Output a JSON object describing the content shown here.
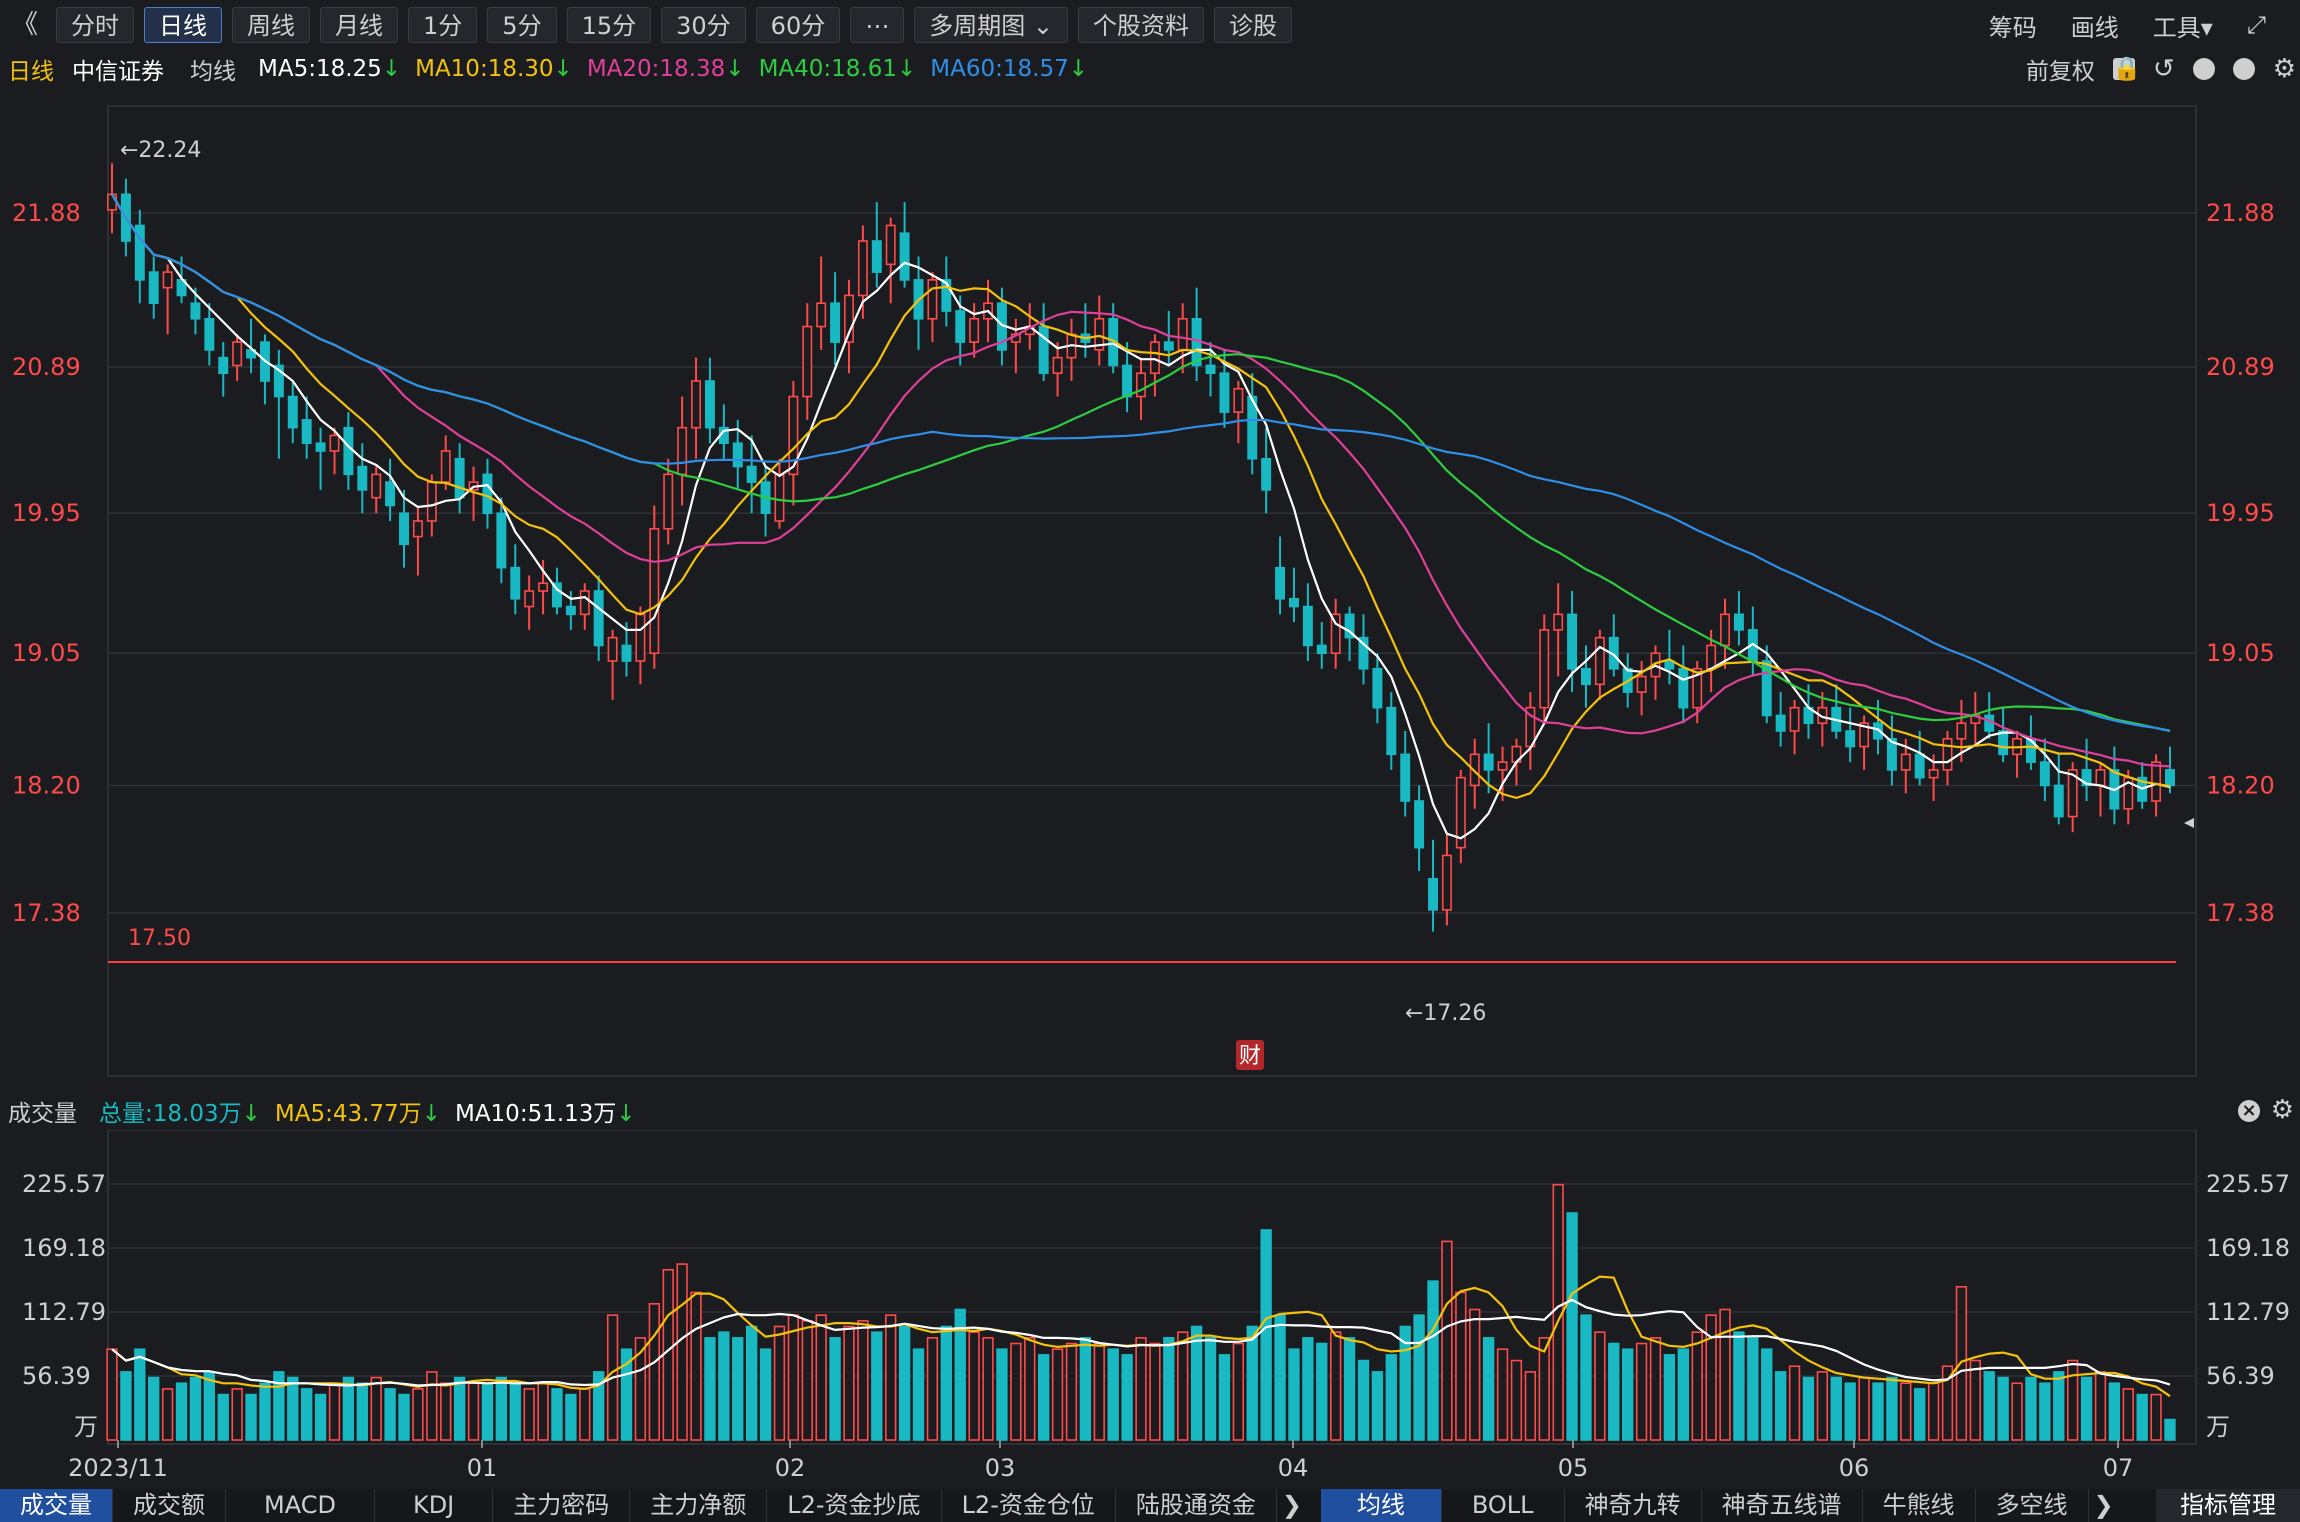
{
  "toolbar": {
    "back": "《",
    "tabs": [
      "分时",
      "日线",
      "周线",
      "月线",
      "1分",
      "5分",
      "15分",
      "30分",
      "60分",
      "⋯",
      "多周期图 ⌄",
      "个股资料",
      "诊股"
    ],
    "active_tab": "日线",
    "right": [
      "筹码",
      "画线",
      "工具▾",
      "⤢"
    ]
  },
  "info": {
    "period": "日线",
    "stock": "中信证券",
    "mode": "均线",
    "ma5": "MA5:18.25",
    "ma10": "MA10:18.30",
    "ma20": "MA20:18.38",
    "ma40": "MA40:18.61",
    "ma60": "MA60:18.57",
    "down": "↓",
    "adjust": "前复权"
  },
  "colors": {
    "up": "#ff4a4a",
    "down": "#19b9c4",
    "ma5": "#ffffff",
    "ma10": "#f4c20d",
    "ma20": "#e0409a",
    "ma40": "#2ecc40",
    "ma60": "#2f8fe8",
    "grid": "#2e3036"
  },
  "price_axis": {
    "ticks": [
      "21.88",
      "20.89",
      "19.95",
      "19.05",
      "18.20",
      "17.38"
    ]
  },
  "annotations": {
    "high": "←22.24",
    "low": "←17.26",
    "support_label": "17.50",
    "finance_badge": "财"
  },
  "volume": {
    "title": "成交量",
    "total": "总量:18.03万",
    "ma5": "MA5:43.77万",
    "ma10": "MA10:51.13万",
    "ticks": [
      "225.57",
      "169.18",
      "112.79",
      "56.39"
    ],
    "unit": "万"
  },
  "x_axis": {
    "labels": [
      "2023/11",
      "01",
      "02",
      "03",
      "04",
      "05",
      "06",
      "07"
    ]
  },
  "chart_data": {
    "type": "candlestick",
    "ylim": [
      17.1,
      22.5
    ],
    "volume_ylim": [
      0,
      240
    ],
    "x_labels": [
      "2023/11",
      "01",
      "02",
      "03",
      "04",
      "05",
      "06",
      "07"
    ],
    "candles_ohlcv": [
      [
        21.9,
        22.2,
        21.75,
        22.0,
        80
      ],
      [
        22.0,
        22.1,
        21.6,
        21.7,
        60
      ],
      [
        21.8,
        21.9,
        21.3,
        21.45,
        80
      ],
      [
        21.5,
        21.6,
        21.2,
        21.3,
        55
      ],
      [
        21.4,
        21.55,
        21.1,
        21.5,
        45
      ],
      [
        21.45,
        21.6,
        21.3,
        21.35,
        50
      ],
      [
        21.3,
        21.4,
        21.1,
        21.2,
        55
      ],
      [
        21.2,
        21.3,
        20.9,
        21.0,
        60
      ],
      [
        20.95,
        21.05,
        20.7,
        20.85,
        40
      ],
      [
        20.9,
        21.1,
        20.8,
        21.05,
        45
      ],
      [
        21.0,
        21.2,
        20.85,
        20.95,
        40
      ],
      [
        21.05,
        21.1,
        20.65,
        20.8,
        50
      ],
      [
        20.9,
        21.0,
        20.3,
        20.7,
        60
      ],
      [
        20.7,
        20.8,
        20.4,
        20.5,
        55
      ],
      [
        20.55,
        20.7,
        20.3,
        20.4,
        45
      ],
      [
        20.4,
        20.5,
        20.1,
        20.35,
        40
      ],
      [
        20.35,
        20.5,
        20.2,
        20.45,
        50
      ],
      [
        20.5,
        20.6,
        20.1,
        20.2,
        55
      ],
      [
        20.25,
        20.4,
        19.95,
        20.1,
        50
      ],
      [
        20.05,
        20.25,
        19.95,
        20.2,
        55
      ],
      [
        20.15,
        20.3,
        19.9,
        20.0,
        45
      ],
      [
        19.95,
        20.1,
        19.6,
        19.75,
        40
      ],
      [
        19.8,
        20.0,
        19.55,
        19.9,
        45
      ],
      [
        19.9,
        20.2,
        19.8,
        20.15,
        60
      ],
      [
        20.15,
        20.45,
        20.1,
        20.35,
        50
      ],
      [
        20.3,
        20.4,
        19.95,
        20.05,
        55
      ],
      [
        20.1,
        20.25,
        19.9,
        20.15,
        50
      ],
      [
        20.2,
        20.3,
        19.85,
        19.95,
        50
      ],
      [
        19.95,
        20.05,
        19.5,
        19.6,
        55
      ],
      [
        19.6,
        19.75,
        19.3,
        19.4,
        50
      ],
      [
        19.35,
        19.55,
        19.2,
        19.45,
        45
      ],
      [
        19.45,
        19.65,
        19.3,
        19.5,
        50
      ],
      [
        19.5,
        19.6,
        19.3,
        19.35,
        45
      ],
      [
        19.35,
        19.45,
        19.2,
        19.3,
        40
      ],
      [
        19.3,
        19.5,
        19.2,
        19.45,
        45
      ],
      [
        19.45,
        19.55,
        19.0,
        19.1,
        60
      ],
      [
        19.0,
        19.2,
        18.75,
        19.15,
        110
      ],
      [
        19.1,
        19.25,
        18.9,
        19.0,
        80
      ],
      [
        19.0,
        19.35,
        18.85,
        19.3,
        90
      ],
      [
        19.05,
        20.0,
        18.95,
        19.85,
        120
      ],
      [
        19.85,
        20.3,
        19.75,
        20.2,
        150
      ],
      [
        20.2,
        20.7,
        20.0,
        20.5,
        155
      ],
      [
        20.5,
        20.95,
        20.3,
        20.8,
        130
      ],
      [
        20.8,
        20.95,
        20.4,
        20.5,
        90
      ],
      [
        20.5,
        20.65,
        20.3,
        20.4,
        95
      ],
      [
        20.4,
        20.55,
        20.1,
        20.25,
        90
      ],
      [
        20.25,
        20.45,
        19.95,
        20.15,
        100
      ],
      [
        20.15,
        20.25,
        19.8,
        19.95,
        80
      ],
      [
        19.9,
        20.3,
        19.85,
        20.2,
        100
      ],
      [
        20.2,
        20.8,
        20.0,
        20.7,
        110
      ],
      [
        20.7,
        21.3,
        20.55,
        21.15,
        105
      ],
      [
        21.15,
        21.6,
        21.0,
        21.3,
        110
      ],
      [
        21.3,
        21.5,
        20.9,
        21.05,
        90
      ],
      [
        21.05,
        21.45,
        20.85,
        21.35,
        100
      ],
      [
        21.35,
        21.8,
        21.2,
        21.7,
        105
      ],
      [
        21.7,
        21.95,
        21.4,
        21.5,
        95
      ],
      [
        21.55,
        21.85,
        21.3,
        21.8,
        110
      ],
      [
        21.75,
        21.95,
        21.4,
        21.45,
        100
      ],
      [
        21.45,
        21.6,
        21.0,
        21.2,
        80
      ],
      [
        21.2,
        21.5,
        21.05,
        21.45,
        90
      ],
      [
        21.45,
        21.6,
        21.15,
        21.25,
        100
      ],
      [
        21.25,
        21.35,
        20.9,
        21.05,
        115
      ],
      [
        21.05,
        21.3,
        20.95,
        21.2,
        95
      ],
      [
        21.2,
        21.45,
        21.05,
        21.3,
        90
      ],
      [
        21.3,
        21.4,
        20.9,
        21.0,
        80
      ],
      [
        21.05,
        21.2,
        20.85,
        21.1,
        85
      ],
      [
        21.1,
        21.3,
        21.0,
        21.15,
        90
      ],
      [
        21.15,
        21.3,
        20.8,
        20.85,
        75
      ],
      [
        20.85,
        21.05,
        20.7,
        20.95,
        80
      ],
      [
        20.95,
        21.2,
        20.8,
        21.1,
        85
      ],
      [
        21.1,
        21.3,
        20.95,
        21.05,
        90
      ],
      [
        21.0,
        21.35,
        20.9,
        21.2,
        85
      ],
      [
        21.2,
        21.3,
        20.85,
        20.9,
        80
      ],
      [
        20.9,
        21.05,
        20.6,
        20.7,
        75
      ],
      [
        20.7,
        20.95,
        20.55,
        20.85,
        90
      ],
      [
        20.85,
        21.1,
        20.7,
        21.05,
        85
      ],
      [
        21.05,
        21.25,
        20.9,
        21.0,
        90
      ],
      [
        21.0,
        21.3,
        20.85,
        21.2,
        95
      ],
      [
        21.2,
        21.4,
        20.8,
        20.9,
        100
      ],
      [
        20.9,
        21.05,
        20.7,
        20.85,
        90
      ],
      [
        20.85,
        21.0,
        20.5,
        20.6,
        75
      ],
      [
        20.6,
        20.8,
        20.4,
        20.75,
        85
      ],
      [
        20.7,
        20.85,
        20.2,
        20.3,
        100
      ],
      [
        20.3,
        20.5,
        19.95,
        20.1,
        185
      ],
      [
        19.6,
        19.8,
        19.3,
        19.4,
        110
      ],
      [
        19.4,
        19.6,
        19.25,
        19.35,
        80
      ],
      [
        19.35,
        19.5,
        19.0,
        19.1,
        90
      ],
      [
        19.1,
        19.25,
        18.95,
        19.05,
        85
      ],
      [
        19.05,
        19.4,
        18.95,
        19.3,
        95
      ],
      [
        19.3,
        19.35,
        19.0,
        19.15,
        90
      ],
      [
        19.15,
        19.3,
        18.85,
        18.95,
        70
      ],
      [
        18.95,
        19.05,
        18.6,
        18.7,
        60
      ],
      [
        18.7,
        18.8,
        18.3,
        18.4,
        75
      ],
      [
        18.4,
        18.55,
        18.0,
        18.1,
        100
      ],
      [
        18.1,
        18.2,
        17.65,
        17.8,
        110
      ],
      [
        17.6,
        17.85,
        17.26,
        17.4,
        140
      ],
      [
        17.4,
        17.9,
        17.3,
        17.75,
        175
      ],
      [
        17.8,
        18.3,
        17.7,
        18.25,
        130
      ],
      [
        18.2,
        18.5,
        18.05,
        18.4,
        115
      ],
      [
        18.4,
        18.6,
        18.15,
        18.3,
        90
      ],
      [
        18.3,
        18.45,
        18.1,
        18.35,
        80
      ],
      [
        18.35,
        18.5,
        18.2,
        18.45,
        70
      ],
      [
        18.45,
        18.8,
        18.3,
        18.7,
        60
      ],
      [
        18.7,
        19.3,
        18.6,
        19.2,
        90
      ],
      [
        19.2,
        19.5,
        18.9,
        19.3,
        225
      ],
      [
        19.3,
        19.45,
        18.8,
        18.95,
        200
      ],
      [
        18.95,
        19.1,
        18.7,
        18.85,
        110
      ],
      [
        18.85,
        19.2,
        18.75,
        19.15,
        95
      ],
      [
        19.15,
        19.3,
        18.9,
        18.95,
        85
      ],
      [
        18.95,
        19.05,
        18.7,
        18.8,
        80
      ],
      [
        18.8,
        19.0,
        18.65,
        18.9,
        85
      ],
      [
        18.9,
        19.1,
        18.75,
        19.05,
        90
      ],
      [
        19.0,
        19.2,
        18.85,
        18.95,
        75
      ],
      [
        18.95,
        19.1,
        18.6,
        18.7,
        80
      ],
      [
        18.7,
        19.0,
        18.6,
        18.95,
        95
      ],
      [
        18.95,
        19.2,
        18.8,
        19.1,
        110
      ],
      [
        19.1,
        19.4,
        18.95,
        19.3,
        115
      ],
      [
        19.3,
        19.45,
        19.1,
        19.2,
        95
      ],
      [
        19.2,
        19.35,
        18.9,
        19.0,
        90
      ],
      [
        19.0,
        19.1,
        18.6,
        18.65,
        80
      ],
      [
        18.65,
        18.8,
        18.45,
        18.55,
        60
      ],
      [
        18.55,
        18.75,
        18.4,
        18.7,
        65
      ],
      [
        18.7,
        18.85,
        18.5,
        18.6,
        55
      ],
      [
        18.6,
        18.8,
        18.45,
        18.7,
        60
      ],
      [
        18.7,
        18.85,
        18.5,
        18.55,
        55
      ],
      [
        18.55,
        18.7,
        18.35,
        18.45,
        50
      ],
      [
        18.45,
        18.65,
        18.3,
        18.6,
        55
      ],
      [
        18.6,
        18.75,
        18.4,
        18.5,
        50
      ],
      [
        18.5,
        18.65,
        18.2,
        18.3,
        55
      ],
      [
        18.3,
        18.5,
        18.15,
        18.4,
        50
      ],
      [
        18.4,
        18.55,
        18.2,
        18.25,
        45
      ],
      [
        18.25,
        18.4,
        18.1,
        18.3,
        50
      ],
      [
        18.3,
        18.55,
        18.2,
        18.5,
        65
      ],
      [
        18.5,
        18.75,
        18.35,
        18.6,
        135
      ],
      [
        18.6,
        18.8,
        18.45,
        18.65,
        70
      ],
      [
        18.65,
        18.8,
        18.5,
        18.55,
        60
      ],
      [
        18.55,
        18.7,
        18.35,
        18.4,
        55
      ],
      [
        18.4,
        18.55,
        18.25,
        18.5,
        50
      ],
      [
        18.5,
        18.65,
        18.3,
        18.35,
        55
      ],
      [
        18.35,
        18.5,
        18.1,
        18.2,
        50
      ],
      [
        18.2,
        18.4,
        17.95,
        18.0,
        60
      ],
      [
        18.0,
        18.35,
        17.9,
        18.3,
        70
      ],
      [
        18.3,
        18.5,
        18.1,
        18.2,
        55
      ],
      [
        18.2,
        18.35,
        18.0,
        18.3,
        60
      ],
      [
        18.3,
        18.45,
        17.95,
        18.05,
        50
      ],
      [
        18.05,
        18.3,
        17.95,
        18.25,
        45
      ],
      [
        18.25,
        18.35,
        18.05,
        18.1,
        40
      ],
      [
        18.1,
        18.4,
        18.0,
        18.35,
        40
      ],
      [
        18.3,
        18.45,
        18.15,
        18.2,
        18
      ]
    ]
  }
}
